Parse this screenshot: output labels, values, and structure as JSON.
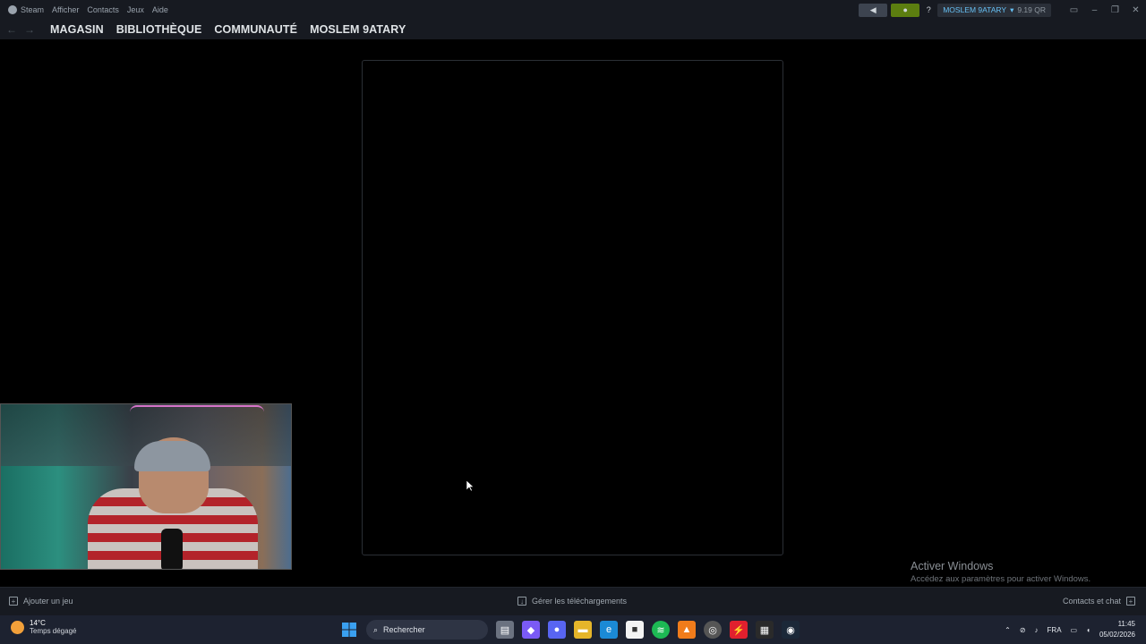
{
  "menubar": {
    "app_label": "Steam",
    "items": [
      "Afficher",
      "Contacts",
      "Jeux",
      "Aide"
    ],
    "help_label": "?",
    "account_name": "MOSLEM 9ATARY",
    "account_balance": "9.19 QR"
  },
  "nav": {
    "links": [
      "MAGASIN",
      "BIBLIOTHÈQUE",
      "COMMUNAUTÉ",
      "MOSLEM 9ATARY"
    ]
  },
  "watermark": {
    "title": "Activer Windows",
    "subtitle": "Accédez aux paramètres pour activer Windows."
  },
  "statusbar": {
    "add_game": "Ajouter un jeu",
    "downloads": "Gérer les téléchargements",
    "friends": "Contacts et chat"
  },
  "taskbar": {
    "temperature": "14°C",
    "weather": "Temps dégagé",
    "search_placeholder": "Rechercher",
    "language": "FRA",
    "time": "11:45",
    "date": "05/02/2026"
  },
  "colors": {
    "notification_green": "#5c7e10",
    "account_blue": "#66c0f4"
  }
}
